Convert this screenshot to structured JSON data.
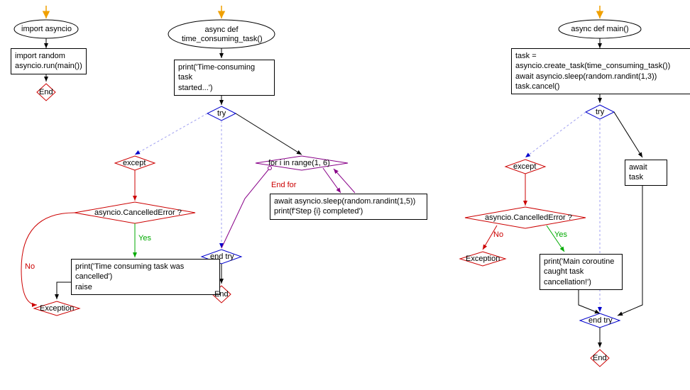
{
  "chart_data": {
    "type": "flowchart",
    "sections": [
      {
        "id": "section1",
        "start": "import asyncio",
        "body": [
          "import random",
          "asyncio.run(main())"
        ],
        "end": "End"
      },
      {
        "id": "section2",
        "start": "async def time_consuming_task()",
        "body": [
          "print('Time-consuming task started...')"
        ],
        "try": {
          "body_loop": {
            "header": "for i in range(1, 6)",
            "body": [
              "await asyncio.sleep(random.randint(1,5))",
              "print(f'Step {i} completed')"
            ],
            "end_label": "End for"
          },
          "except": {
            "label": "except",
            "condition": "asyncio.CancelledError ?",
            "yes": [
              "print('Time consuming task was cancelled')",
              "raise"
            ],
            "no": "Exception"
          },
          "end": "end try"
        },
        "end": "End"
      },
      {
        "id": "section3",
        "start": "async def main()",
        "body": [
          "task = asyncio.create_task(time_consuming_task())",
          "await asyncio.sleep(random.randint(1,3))",
          "task.cancel()"
        ],
        "try": {
          "body": [
            "await task"
          ],
          "except": {
            "label": "except",
            "condition": "asyncio.CancelledError ?",
            "yes": [
              "print('Main coroutine caught task cancellation!')"
            ],
            "no": "Exception"
          },
          "end": "end try"
        },
        "end": "End"
      }
    ]
  },
  "labels": {
    "import_asyncio": "import asyncio",
    "import_random_run": "import random\nasyncio.run(main())",
    "end": "End",
    "async_def_tct": "async def\ntime_consuming_task()",
    "print_started": "print('Time-consuming task\nstarted...')",
    "try": "try",
    "except": "except",
    "for_range": "for i in range(1, 6)",
    "end_for": "End for",
    "await_sleep_print": "await asyncio.sleep(random.randint(1,5))\nprint(f'Step {i} completed')",
    "cancelled_error": "asyncio.CancelledError ?",
    "print_cancelled_raise": "print('Time consuming task was cancelled')\nraise",
    "exception": "Exception",
    "end_try": "end try",
    "async_def_main": "async def main()",
    "main_body": "task = asyncio.create_task(time_consuming_task())\nawait asyncio.sleep(random.randint(1,3))\ntask.cancel()",
    "await_task": "await task",
    "print_main_caught": "print('Main coroutine\ncaught task\ncancellation!')",
    "yes": "Yes",
    "no": "No"
  }
}
